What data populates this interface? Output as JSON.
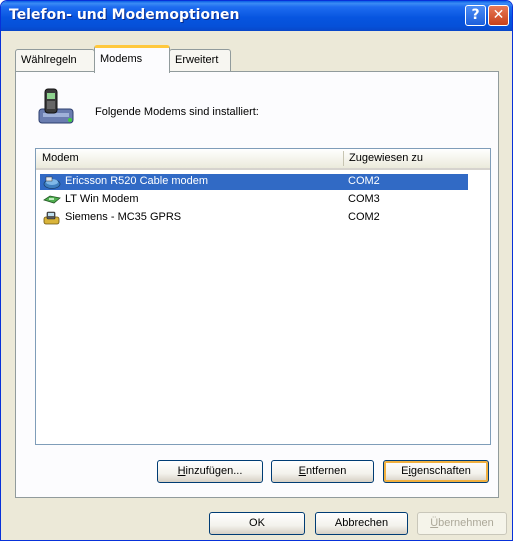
{
  "window": {
    "title": "Telefon- und Modemoptionen",
    "help_glyph": "?",
    "close_glyph": "✕"
  },
  "tabs": [
    {
      "label": "Wählregeln"
    },
    {
      "label": "Modems"
    },
    {
      "label": "Erweitert"
    }
  ],
  "intro_text": "Folgende Modems sind installiert:",
  "list": {
    "columns": [
      "Modem",
      "Zugewiesen zu"
    ],
    "rows": [
      {
        "modem": "Ericsson R520 Cable modem",
        "port": "COM2",
        "icon": "cable-modem-icon",
        "selected": true
      },
      {
        "modem": "LT Win Modem",
        "port": "COM3",
        "icon": "win-modem-icon",
        "selected": false
      },
      {
        "modem": "Siemens - MC35 GPRS",
        "port": "COM2",
        "icon": "gprs-modem-icon",
        "selected": false
      }
    ]
  },
  "action_buttons": {
    "add": {
      "ul": "H",
      "rest": "inzufügen..."
    },
    "remove": {
      "ul": "E",
      "rest": "ntfernen"
    },
    "properties": {
      "pre": "E",
      "ul": "i",
      "rest": "genschaften"
    }
  },
  "dialog_buttons": {
    "ok": "OK",
    "cancel": "Abbrechen",
    "apply": {
      "ul": "Ü",
      "rest": "bernehmen"
    }
  },
  "colors": {
    "titlebar": "#0755e0",
    "selection": "#316ac5",
    "active_tab_accent": "#ffc83c",
    "dialog_bg": "#ece9d8"
  }
}
